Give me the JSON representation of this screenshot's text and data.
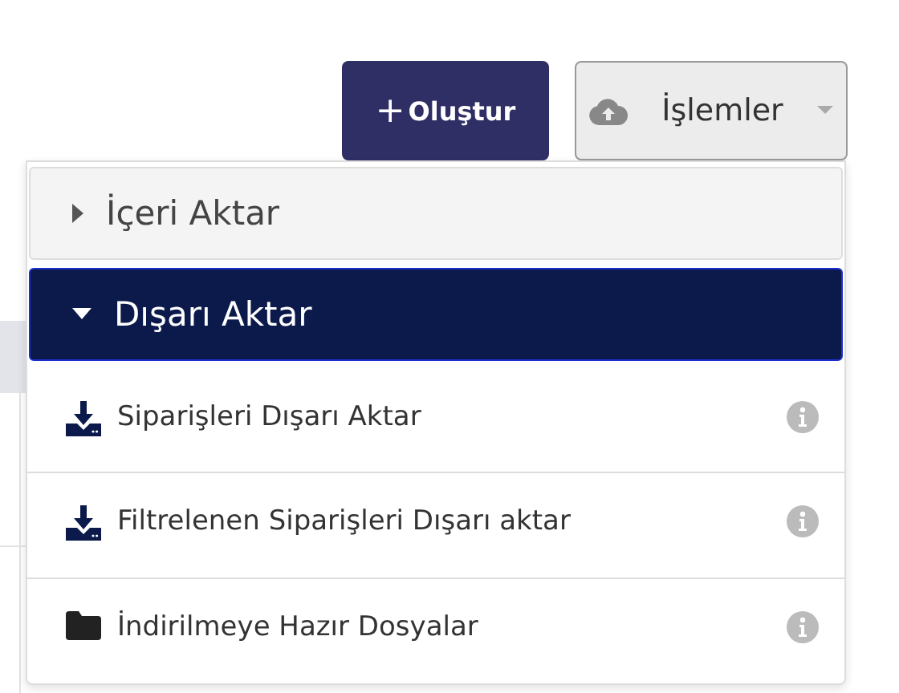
{
  "toolbar": {
    "create_button": {
      "icon": "+",
      "label": "Oluştur"
    },
    "actions_button": {
      "label": "İşlemler",
      "expanded": true
    }
  },
  "menu": {
    "sections": [
      {
        "title": "İçeri Aktar",
        "expanded": false
      },
      {
        "title": "Dışarı Aktar",
        "expanded": true,
        "items": [
          {
            "kind": "download",
            "label": "Siparişleri Dışarı Aktar"
          },
          {
            "kind": "download",
            "label": "Filtrelenen Siparişleri Dışarı aktar"
          }
        ]
      }
    ],
    "footer_items": [
      {
        "kind": "folder",
        "label": "İndirilmeye Hazır Dosyalar"
      }
    ]
  }
}
